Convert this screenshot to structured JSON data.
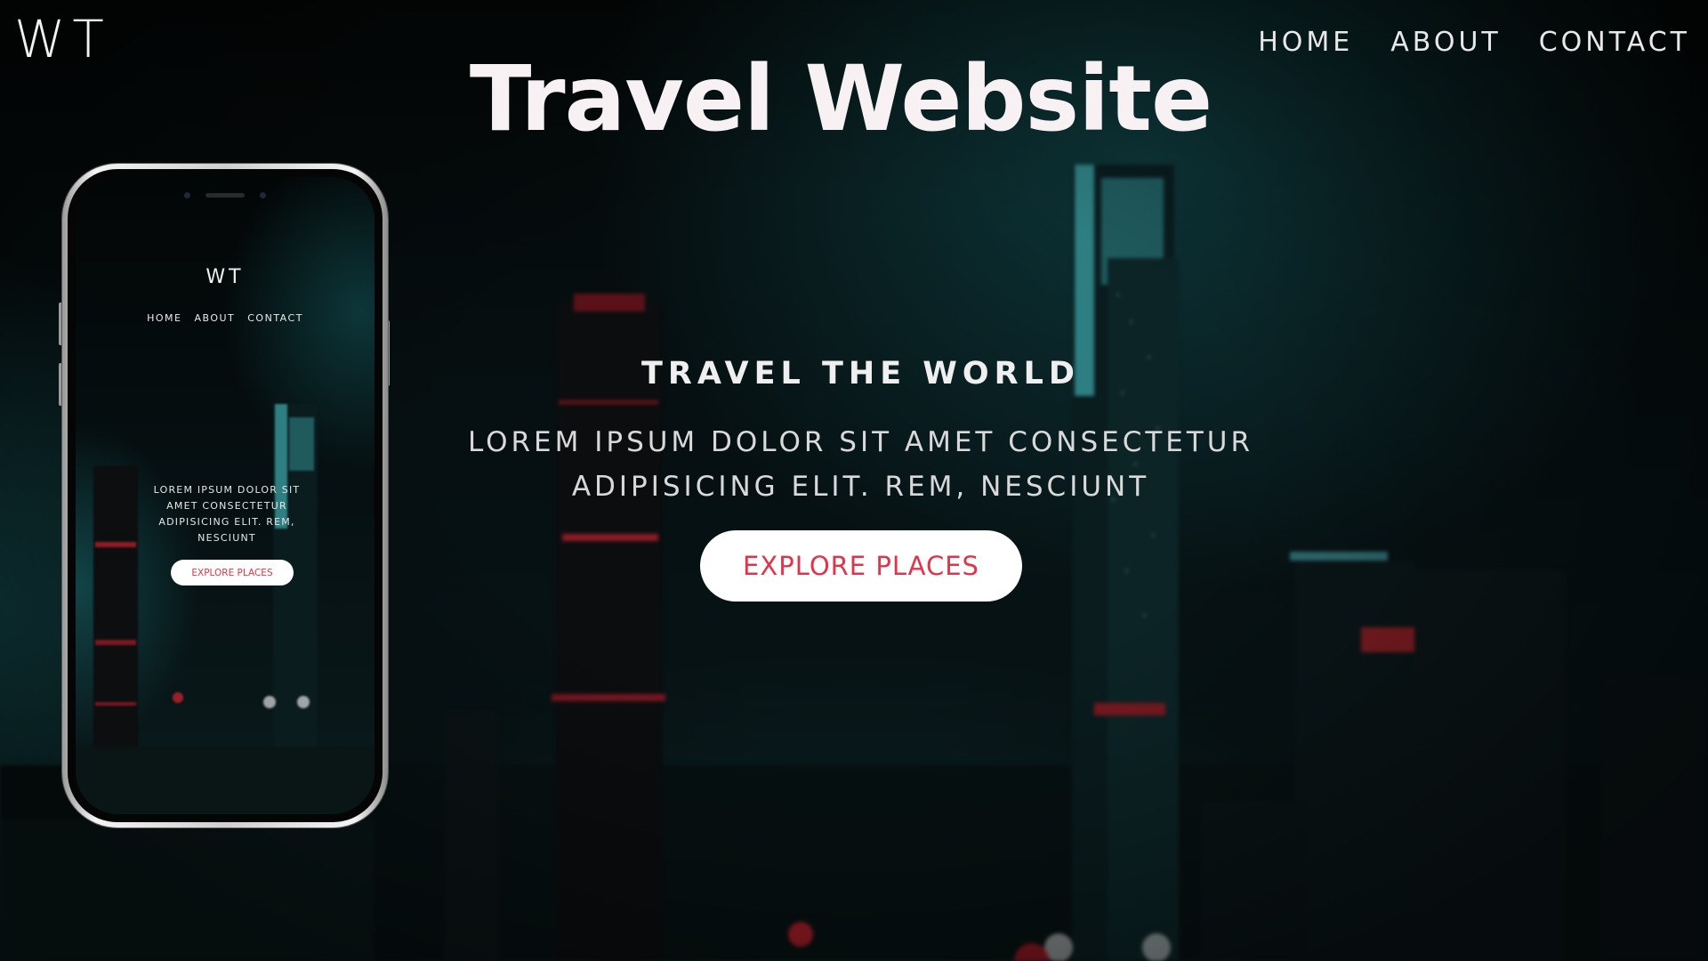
{
  "overlay_title": "Travel Website",
  "header": {
    "logo": "WT",
    "nav": [
      "HOME",
      "ABOUT",
      "CONTACT"
    ]
  },
  "hero": {
    "heading": "TRAVEL THE WORLD",
    "text_line1": "LOREM IPSUM DOLOR SIT AMET CONSECTETUR",
    "text_line2": "ADIPISICING ELIT. REM, NESCIUNT",
    "button_label": "EXPLORE PLACES"
  },
  "phone": {
    "logo": "WT",
    "nav": [
      "HOME",
      "ABOUT",
      "CONTACT"
    ],
    "text_line1": "LOREM IPSUM DOLOR SIT",
    "text_line2": "AMET CONSECTETUR",
    "text_line3": "ADIPISICING ELIT. REM,",
    "text_line4": "NESCIUNT",
    "button_label": "EXPLORE PLACES"
  },
  "colors": {
    "accent": "#e0344a",
    "background": "#061012",
    "text": "#efefef"
  }
}
